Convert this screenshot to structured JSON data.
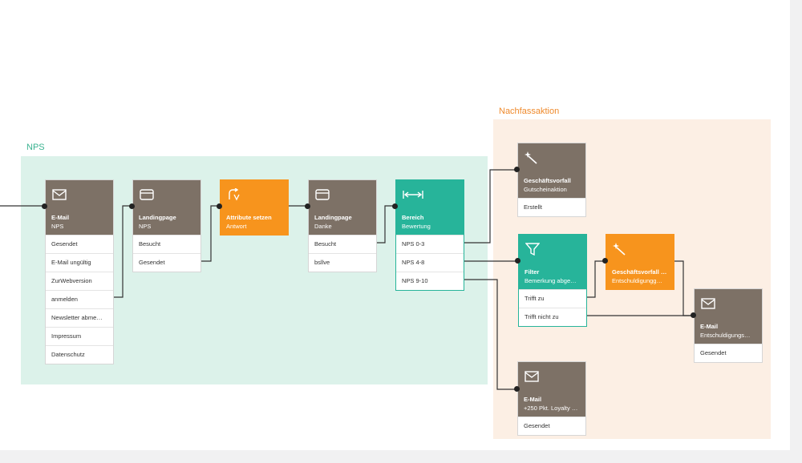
{
  "groups": {
    "nps": {
      "label": "NPS",
      "color": "#dcf2ea",
      "label_color": "#39b28f"
    },
    "nachfass": {
      "label": "Nachfassaktion",
      "color": "#fcefe4",
      "label_color": "#ef8a2c"
    }
  },
  "colors": {
    "brown": "#7d7166",
    "orange": "#f7941d",
    "teal": "#27b49a",
    "wire": "#333333"
  },
  "nodes": {
    "email_nps": {
      "icon": "envelope-icon",
      "title": "E-Mail",
      "subtitle": "NPS",
      "rows": [
        "Gesendet",
        "E-Mail ungültig",
        "ZurWebversion",
        "anmelden",
        "Newsletter abme…",
        "Impressum",
        "Datenschutz"
      ]
    },
    "landing_nps": {
      "icon": "landingpage-icon",
      "title": "Landingpage",
      "subtitle": "NPS",
      "rows": [
        "Besucht",
        "Gesendet"
      ]
    },
    "attribute": {
      "icon": "attribute-set-icon",
      "title": "Attribute setzen",
      "subtitle": "Antwort",
      "rows": []
    },
    "landing_danke": {
      "icon": "landingpage-icon",
      "title": "Landingpage",
      "subtitle": "Danke",
      "rows": [
        "Besucht",
        "bsllve"
      ]
    },
    "bereich": {
      "icon": "range-icon",
      "title": "Bereich",
      "subtitle": "Bewertung",
      "rows": [
        "NPS 0-3",
        "NPS 4-8",
        "NPS 9-10"
      ]
    },
    "gv_gutschein": {
      "icon": "magic-wand-icon",
      "title": "Geschäftsvorfall",
      "subtitle": "Gutscheinaktion",
      "rows": [
        "Erstellt"
      ]
    },
    "filter": {
      "icon": "filter-icon",
      "title": "Filter",
      "subtitle": "Bemerkung abge…",
      "rows": [
        "Trifft zu",
        "Trifft nicht zu"
      ]
    },
    "gv_entschuld": {
      "icon": "magic-wand-icon",
      "title": "Geschäftsvorfall …",
      "subtitle": "Entschuldigungg…",
      "rows": []
    },
    "email_entschuld": {
      "icon": "envelope-icon",
      "title": "E-Mail",
      "subtitle": "Entschuldigungs…",
      "rows": [
        "Gesendet"
      ]
    },
    "email_loyalty": {
      "icon": "envelope-icon",
      "title": "E-Mail",
      "subtitle": "+250 Pkt. Loyalty …",
      "rows": [
        "Gesendet"
      ]
    }
  }
}
